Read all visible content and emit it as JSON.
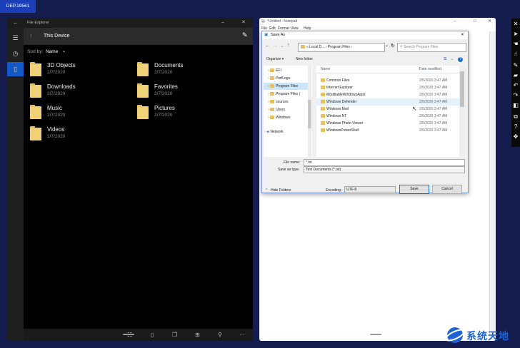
{
  "badge": "DEP.19561",
  "file_explorer": {
    "window_title": "File Explorer",
    "header_title": "This Device",
    "sort_label": "Sort by:",
    "sort_value": "Name",
    "folders": [
      {
        "name": "3D Objects",
        "date": "2/7/2020"
      },
      {
        "name": "Documents",
        "date": "2/7/2020"
      },
      {
        "name": "Downloads",
        "date": "2/7/2020"
      },
      {
        "name": "Favorites",
        "date": "2/7/2020"
      },
      {
        "name": "Music",
        "date": "2/7/2020"
      },
      {
        "name": "Pictures",
        "date": "2/7/2020"
      },
      {
        "name": "Videos",
        "date": "2/7/2020"
      }
    ]
  },
  "notepad": {
    "title": "*Untitled - Notepad",
    "menu": [
      "File",
      "Edit",
      "Format",
      "View",
      "Help"
    ]
  },
  "save_as": {
    "title": "Save As",
    "address": "« Local D... › Program Files ›",
    "search_placeholder": "Search Program Files",
    "organize": "Organize ▾",
    "new_folder": "New folder",
    "tree": [
      {
        "label": "EFI",
        "selected": false
      },
      {
        "label": "PerfLogs",
        "selected": false
      },
      {
        "label": "Program Files",
        "selected": true
      },
      {
        "label": "Program Files (",
        "selected": false
      },
      {
        "label": "sources",
        "selected": false
      },
      {
        "label": "Users",
        "selected": false
      },
      {
        "label": "Windows",
        "selected": false
      },
      {
        "label": "Network",
        "selected": false
      }
    ],
    "col_name": "Name",
    "col_date": "Date modified",
    "files": [
      {
        "name": "Common Files",
        "date": "2/5/2020 3:47 AM"
      },
      {
        "name": "Internet Explorer",
        "date": "2/5/2020 3:47 AM"
      },
      {
        "name": "ModifiableWindowsApps",
        "date": "2/5/2020 3:47 AM"
      },
      {
        "name": "Windows Defender",
        "date": "2/5/2020 3:47 AM"
      },
      {
        "name": "Windows Mail",
        "date": "2/5/2020 3:47 AM"
      },
      {
        "name": "Windows NT",
        "date": "2/5/2020 3:47 AM"
      },
      {
        "name": "Windows Photo Viewer",
        "date": "2/5/2020 3:47 AM"
      },
      {
        "name": "WindowsPowerShell",
        "date": "2/5/2020 3:47 AM"
      }
    ],
    "file_name_label": "File name:",
    "file_name_value": "*.txt",
    "save_type_label": "Save as type:",
    "save_type_value": "Text Documents (*.txt)",
    "hide_folders": "Hide Folders",
    "encoding_label": "Encoding:",
    "encoding_value": "UTF-8",
    "save_btn": "Save",
    "cancel_btn": "Cancel"
  },
  "watermark": "系统天地"
}
